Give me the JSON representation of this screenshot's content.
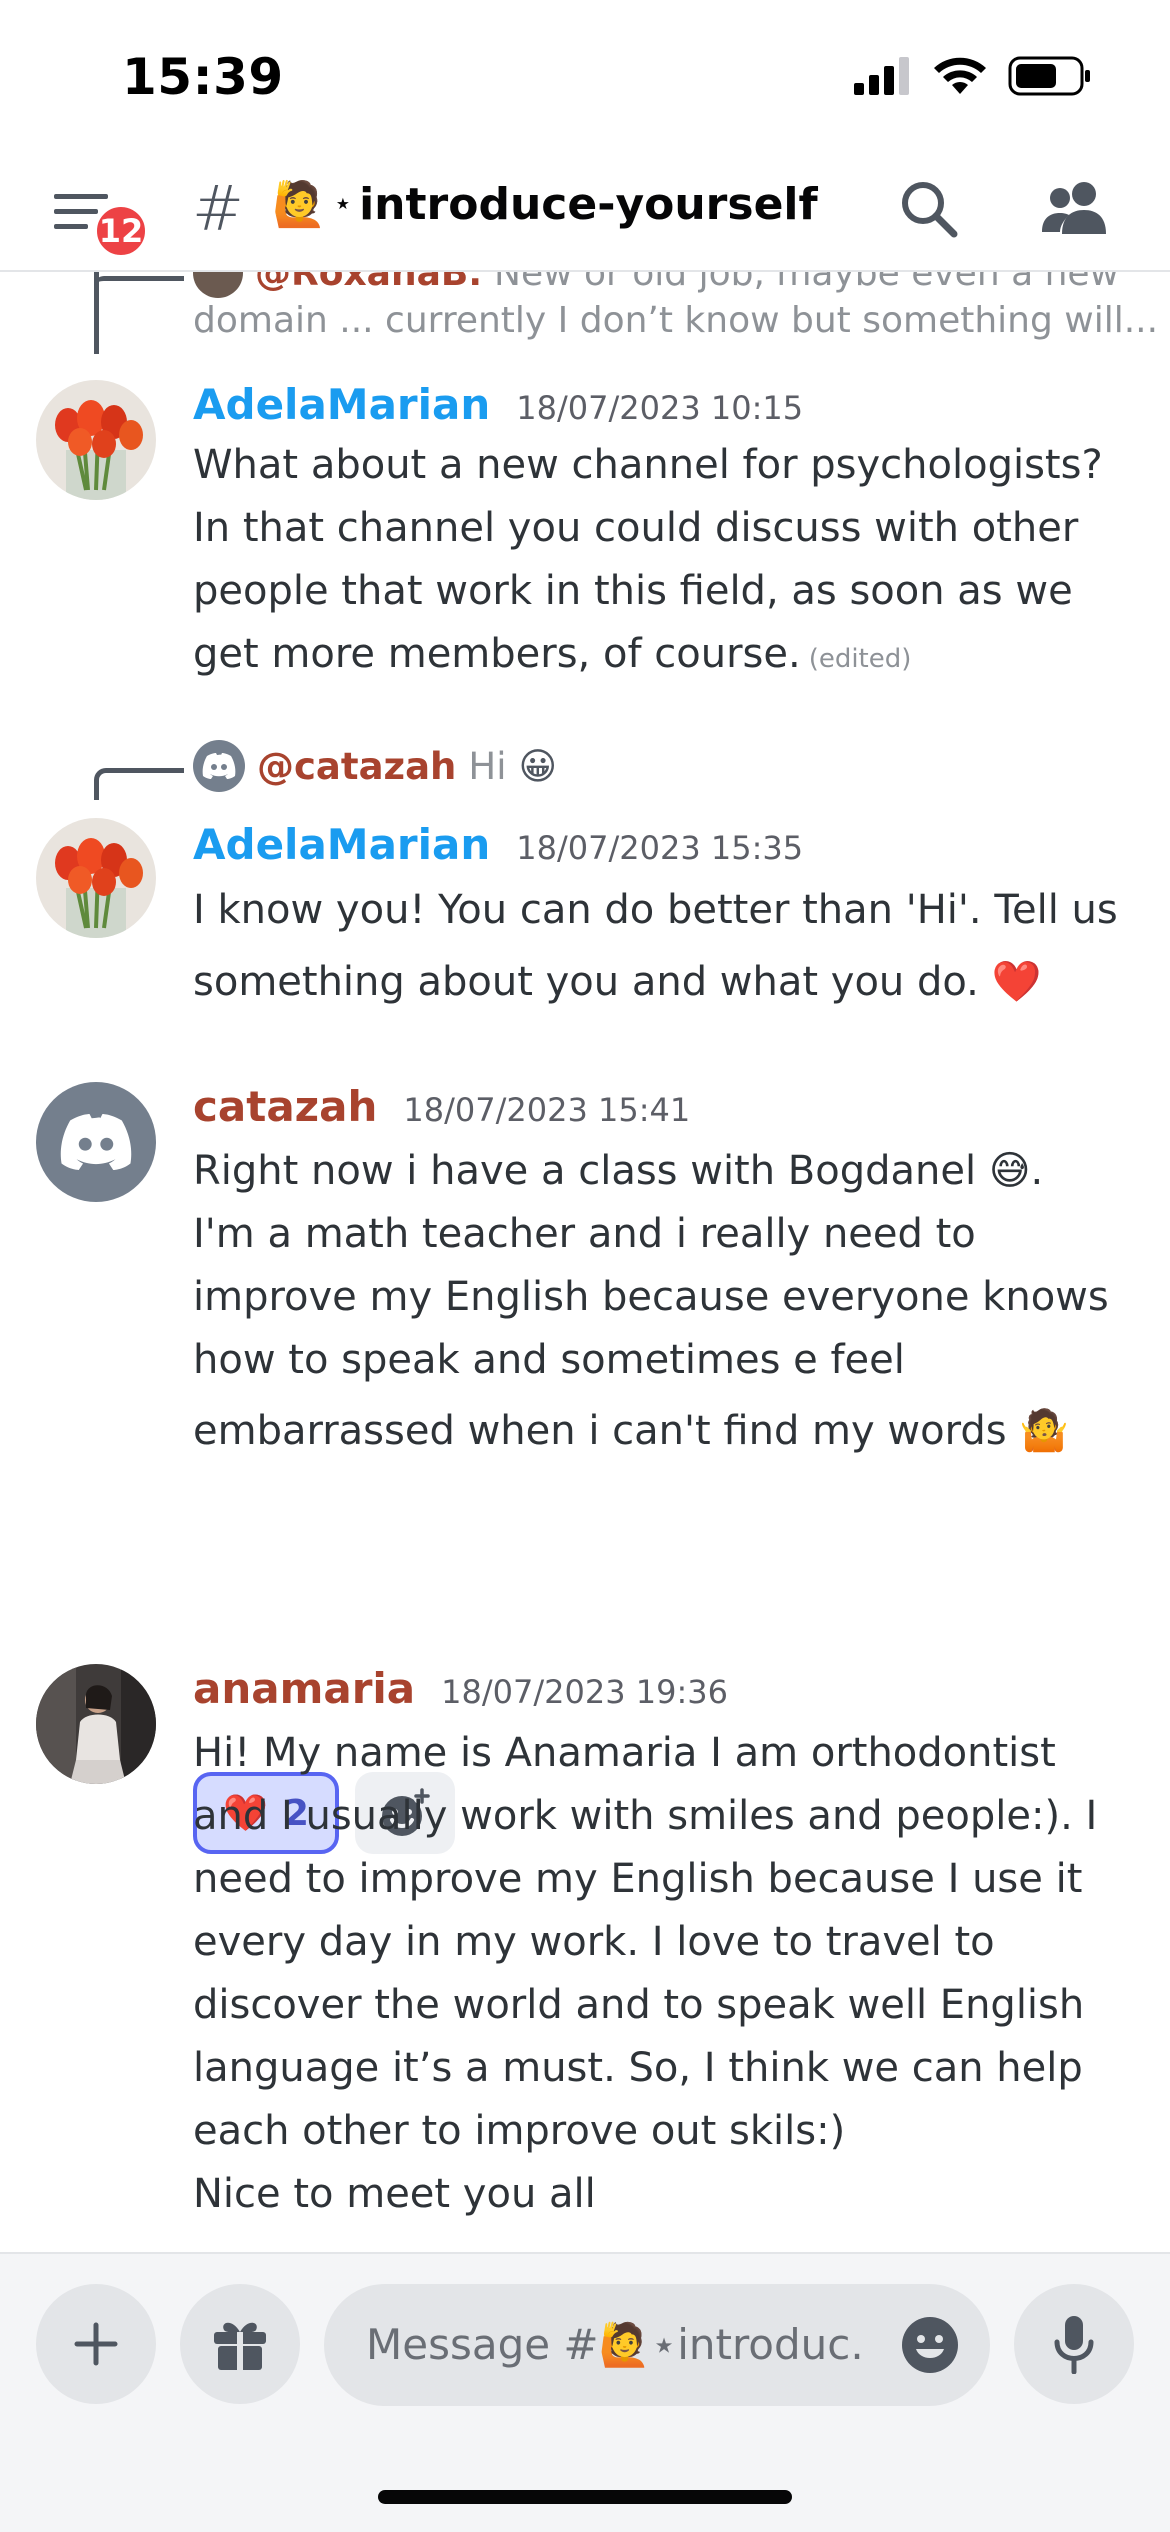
{
  "status_bar": {
    "time": "15:39"
  },
  "header": {
    "badge_count": "12",
    "hash": "#",
    "channel_emoji": "🙋",
    "channel_prefix": "⋆",
    "channel_name": "introduce-yourself"
  },
  "messages": {
    "top_reply": {
      "name": "@RoxanaB.",
      "text": "New or old job, maybe even a new",
      "line2": "domain ... currently I don’t know but something will..."
    },
    "m1": {
      "author": "AdelaMarian",
      "timestamp": "18/07/2023 10:15",
      "lines": [
        "What about a new channel for psychologists?",
        "In that channel you could discuss with other",
        "people that work in this field, as soon as we",
        "get more members, of course."
      ],
      "edited": "(edited)"
    },
    "m2": {
      "reply_name": "@catazah",
      "reply_text": "Hi",
      "reply_emoji": "😀",
      "author": "AdelaMarian",
      "timestamp": "18/07/2023 15:35",
      "lines": [
        "I know you! You can do better than 'Hi'. Tell us",
        "something about you and what you do."
      ],
      "emoji": "❤️"
    },
    "m3": {
      "author": "catazah",
      "timestamp": "18/07/2023 15:41",
      "lines": [
        "Right now i have a class with Bogdanel",
        "I'm a math teacher and i really need to",
        "improve my English because everyone knows",
        "how to speak and sometimes e feel",
        "embarrassed when i can't find my words"
      ],
      "emoji_a": "😅",
      "emoji_b": "🤷",
      "reaction": {
        "emoji": "❤️",
        "count": "2"
      }
    },
    "m4": {
      "author": "anamaria",
      "timestamp": "18/07/2023 19:36",
      "lines": [
        "Hi! My name is Anamaria I am orthodontist",
        "and I usually work with smiles and people:). I",
        "need to improve my English because I use it",
        "every day in my work. I love to travel to",
        "discover the world and to speak well English",
        "language it’s a must. So, I think we can help",
        "each other to improve out skils:)",
        "Nice to meet you all"
      ]
    }
  },
  "composer": {
    "placeholder": "Message #🙋⋆introduc..."
  },
  "colors": {
    "accent": "#5865f2",
    "badge": "#ed4245",
    "name_blue": "#1a9cf0",
    "name_brown": "#a8432e"
  }
}
